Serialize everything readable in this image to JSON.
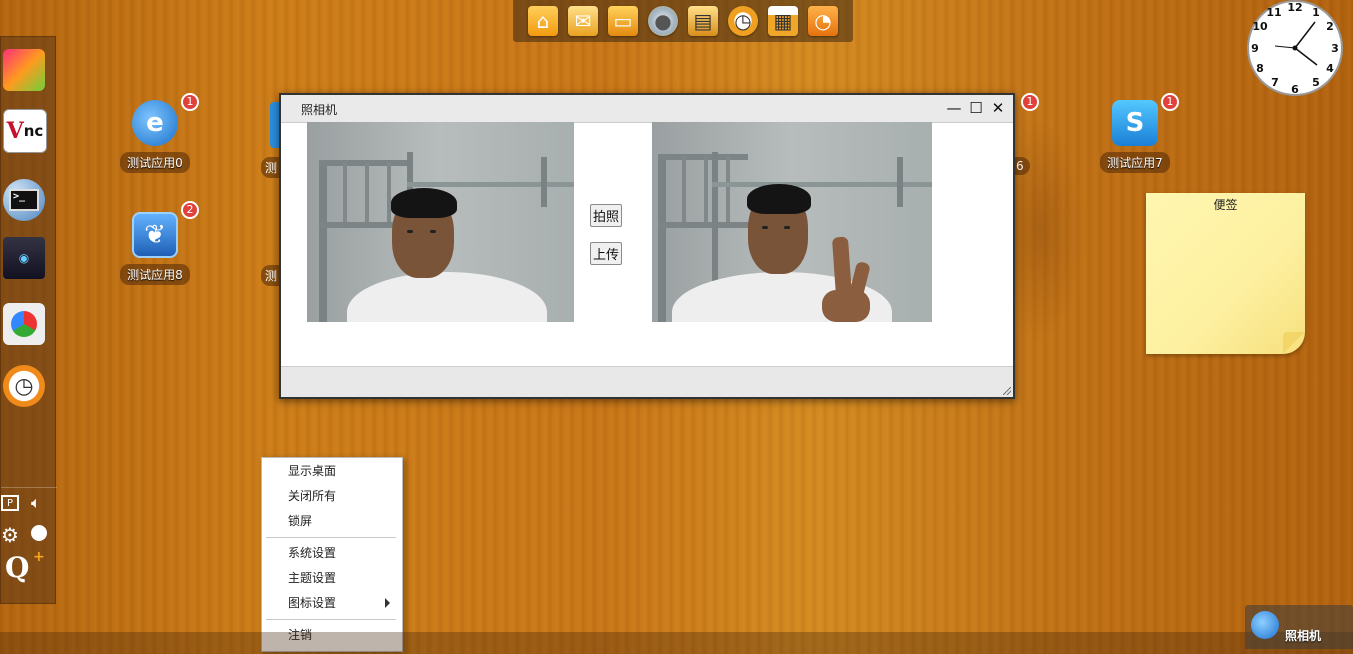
{
  "desktop": {
    "icons": [
      {
        "label": "测试应用0",
        "badge": "1"
      },
      {
        "label": "测试应用8",
        "badge": "2"
      },
      {
        "label": "测试应用7",
        "badge": "1"
      },
      {
        "label": "6",
        "badge": "1"
      }
    ],
    "partial_labels": [
      "测",
      "测"
    ]
  },
  "top_dock": {
    "items": [
      "home-icon",
      "mail-icon",
      "folder-icon",
      "disc-icon",
      "clapper-icon",
      "clock-icon",
      "calendar-icon",
      "rss-icon"
    ]
  },
  "left_dock": {
    "apps": [
      "gallery-icon",
      "vnc-icon",
      "terminal-icon",
      "network-icon",
      "browser-icon",
      "clock-icon"
    ],
    "vnc_text": "nc",
    "vnc_initial": "V",
    "terminal_prompt": ">_",
    "search_label": "Q"
  },
  "camera_window": {
    "title": "照相机",
    "capture_button": "拍照",
    "upload_button": "上传"
  },
  "sticky_note": {
    "title": "便签"
  },
  "clock": {
    "numbers": [
      "12",
      "1",
      "2",
      "3",
      "4",
      "5",
      "6",
      "7",
      "8",
      "9",
      "10",
      "11"
    ]
  },
  "context_menu": {
    "items": [
      "显示桌面",
      "关闭所有",
      "锁屏",
      "系统设置",
      "主题设置",
      "图标设置",
      "注销"
    ]
  },
  "taskbar": {
    "active_item": "照相机"
  }
}
